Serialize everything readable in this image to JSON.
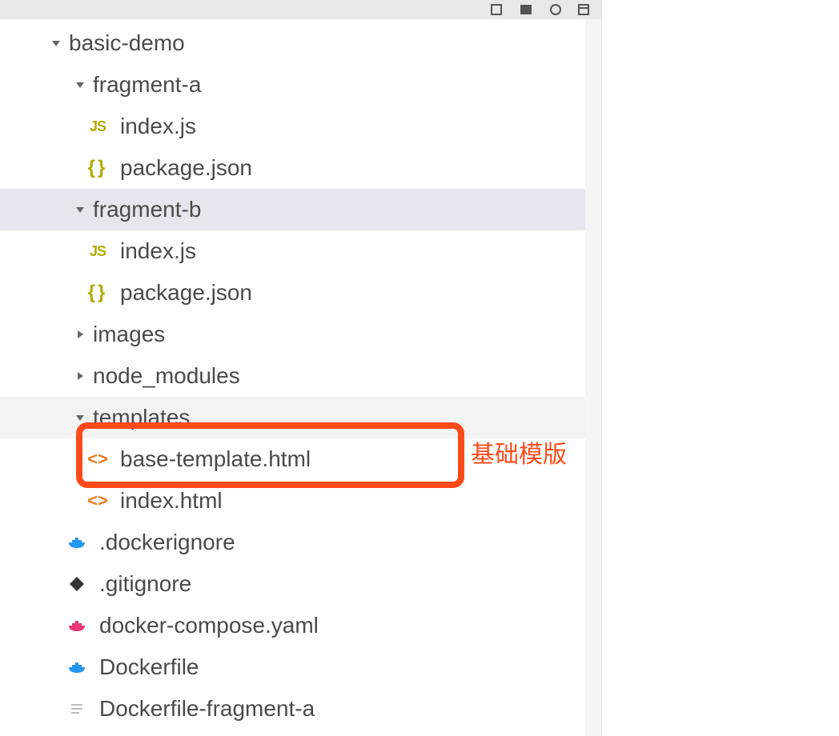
{
  "tree": {
    "root": "basic-demo",
    "items": [
      {
        "label": "basic-demo",
        "type": "folder",
        "expanded": true,
        "indent": 0
      },
      {
        "label": "fragment-a",
        "type": "folder",
        "expanded": true,
        "indent": 1
      },
      {
        "label": "index.js",
        "type": "js",
        "indent": 2
      },
      {
        "label": "package.json",
        "type": "json",
        "indent": 2
      },
      {
        "label": "fragment-b",
        "type": "folder",
        "expanded": true,
        "indent": 1,
        "selected": true
      },
      {
        "label": "index.js",
        "type": "js",
        "indent": 2
      },
      {
        "label": "package.json",
        "type": "json",
        "indent": 2
      },
      {
        "label": "images",
        "type": "folder",
        "expanded": false,
        "indent": 1
      },
      {
        "label": "node_modules",
        "type": "folder",
        "expanded": false,
        "indent": 1
      },
      {
        "label": "templates",
        "type": "folder",
        "expanded": true,
        "indent": 1,
        "shaded": true
      },
      {
        "label": "base-template.html",
        "type": "html",
        "indent": 2
      },
      {
        "label": "index.html",
        "type": "html",
        "indent": 2
      },
      {
        "label": ".dockerignore",
        "type": "docker",
        "indent": 1
      },
      {
        "label": ".gitignore",
        "type": "git",
        "indent": 1
      },
      {
        "label": "docker-compose.yaml",
        "type": "docker-pink",
        "indent": 1
      },
      {
        "label": "Dockerfile",
        "type": "docker",
        "indent": 1
      },
      {
        "label": "Dockerfile-fragment-a",
        "type": "text",
        "indent": 1
      }
    ]
  },
  "annotation": {
    "label": "基础模版"
  }
}
